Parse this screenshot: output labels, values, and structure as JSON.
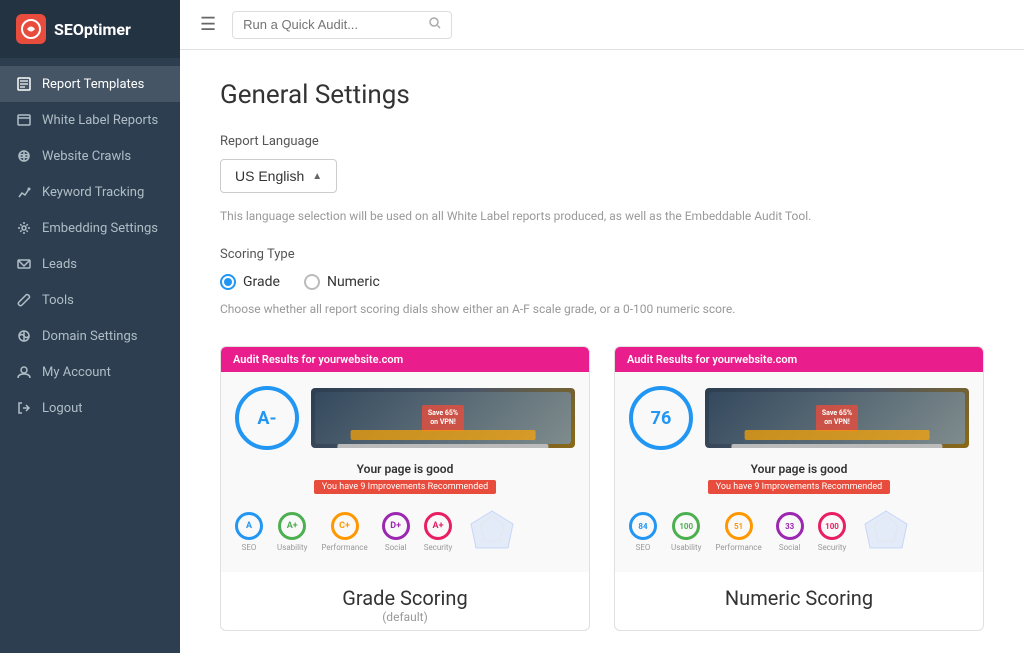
{
  "logo": {
    "text": "SEOptimer",
    "icon_label": "S"
  },
  "topbar": {
    "menu_icon": "☰",
    "search_placeholder": "Run a Quick Audit...",
    "search_icon": "🔍"
  },
  "sidebar": {
    "items": [
      {
        "id": "report-templates",
        "label": "Report Templates",
        "icon": "📄",
        "active": true
      },
      {
        "id": "white-label-reports",
        "label": "White Label Reports",
        "icon": "🏷️",
        "active": false
      },
      {
        "id": "website-crawls",
        "label": "Website Crawls",
        "icon": "🌐",
        "active": false
      },
      {
        "id": "keyword-tracking",
        "label": "Keyword Tracking",
        "icon": "🔑",
        "active": false
      },
      {
        "id": "embedding-settings",
        "label": "Embedding Settings",
        "icon": "⚙️",
        "active": false
      },
      {
        "id": "leads",
        "label": "Leads",
        "icon": "✉️",
        "active": false
      },
      {
        "id": "tools",
        "label": "Tools",
        "icon": "🔧",
        "active": false
      },
      {
        "id": "domain-settings",
        "label": "Domain Settings",
        "icon": "🌍",
        "active": false
      },
      {
        "id": "my-account",
        "label": "My Account",
        "icon": "👤",
        "active": false
      },
      {
        "id": "logout",
        "label": "Logout",
        "icon": "⬆️",
        "active": false
      }
    ]
  },
  "content": {
    "page_title": "General Settings",
    "report_language_label": "Report Language",
    "language_value": "US English",
    "language_arrow": "▲",
    "language_helper": "This language selection will be used on all White Label reports produced, as well as the Embeddable Audit Tool.",
    "scoring_type_label": "Scoring Type",
    "scoring_options": [
      {
        "id": "grade",
        "label": "Grade",
        "selected": true
      },
      {
        "id": "numeric",
        "label": "Numeric",
        "selected": false
      }
    ],
    "scoring_helper": "Choose whether all report scoring dials show either an A-F scale grade, or a 0-100 numeric score.",
    "preview_header": "Audit Results for yourwebsite.com",
    "grade_preview": {
      "score": "A-",
      "good_text": "Your page is good",
      "warning": "You have 9 Improvements Recommended",
      "label": "Grade Scoring",
      "sublabel": "(default)",
      "mini_items": [
        {
          "label": "SEO",
          "value": "A",
          "color": "#2196f3"
        },
        {
          "label": "Usability",
          "value": "A+",
          "color": "#4caf50"
        },
        {
          "label": "Performance",
          "value": "C+",
          "color": "#ff9800"
        },
        {
          "label": "Social",
          "value": "D+",
          "color": "#9c27b0"
        },
        {
          "label": "Security",
          "value": "A+",
          "color": "#e91e63"
        }
      ]
    },
    "numeric_preview": {
      "score": "76",
      "good_text": "Your page is good",
      "warning": "You have 9 Improvements Recommended",
      "label": "Numeric Scoring",
      "sublabel": "",
      "mini_items": [
        {
          "label": "SEO",
          "value": "84",
          "color": "#2196f3"
        },
        {
          "label": "Usability",
          "value": "100",
          "color": "#4caf50"
        },
        {
          "label": "Performance",
          "value": "51",
          "color": "#ff9800"
        },
        {
          "label": "Social",
          "value": "33",
          "color": "#9c27b0"
        },
        {
          "label": "Security",
          "value": "100",
          "color": "#e91e63"
        }
      ]
    }
  }
}
